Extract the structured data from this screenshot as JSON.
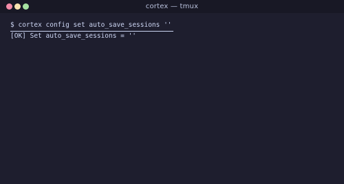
{
  "window": {
    "title": "cortex — tmux",
    "controls": {
      "close_color": "#f38ba8",
      "minimize_color": "#f9e2af",
      "maximize_color": "#a6e3a1"
    }
  },
  "terminal": {
    "prompt": "$",
    "command": "cortex config set auto_save_sessions ''",
    "output": "[OK] Set auto_save_sessions = ''",
    "background": "#1e1e2e",
    "foreground": "#cdd6f4"
  }
}
